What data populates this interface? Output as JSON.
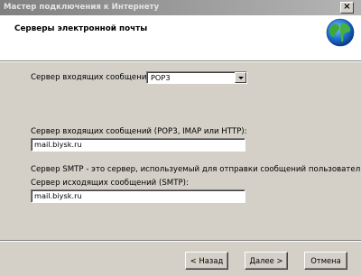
{
  "window": {
    "title": "Мастер подключения к Интернету",
    "close_glyph": "×"
  },
  "header": {
    "title": "Серверы электронной почты",
    "icon": "globe-icon"
  },
  "incoming_type": {
    "label": "Сервер входящих сообщений:",
    "selected": "POP3"
  },
  "incoming_server": {
    "label": "Сервер входящих сообщений (POP3, IMAP или HTTP):",
    "value": "mail.biysk.ru"
  },
  "smtp": {
    "description": "Сервер SMTP - это сервер, используемый для отправки сообщений  пользователя.",
    "label": "Сервер исходящих сообщений (SMTP):",
    "value": "mail.biysk.ru"
  },
  "buttons": {
    "back": {
      "arrow": "<",
      "label": "Назад"
    },
    "next": {
      "label": "Далее",
      "arrow": ">"
    },
    "cancel": {
      "label": "Отмена"
    }
  }
}
